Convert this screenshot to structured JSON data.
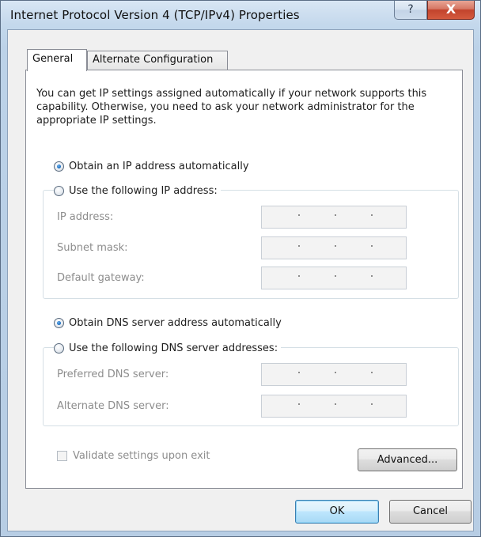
{
  "window": {
    "title": "Internet Protocol Version 4 (TCP/IPv4) Properties",
    "help_glyph": "?",
    "close_glyph": "X"
  },
  "tabs": [
    {
      "label": "General",
      "active": true
    },
    {
      "label": "Alternate Configuration",
      "active": false
    }
  ],
  "general": {
    "description": "You can get IP settings assigned automatically if your network supports this capability. Otherwise, you need to ask your network administrator for the appropriate IP settings.",
    "ip": {
      "auto_label": "Obtain an IP address automatically",
      "manual_label": "Use the following IP address:",
      "selected": "auto",
      "fields": [
        {
          "label": "IP address:",
          "value": ""
        },
        {
          "label": "Subnet mask:",
          "value": ""
        },
        {
          "label": "Default gateway:",
          "value": ""
        }
      ]
    },
    "dns": {
      "auto_label": "Obtain DNS server address automatically",
      "manual_label": "Use the following DNS server addresses:",
      "selected": "auto",
      "fields": [
        {
          "label": "Preferred DNS server:",
          "value": ""
        },
        {
          "label": "Alternate DNS server:",
          "value": ""
        }
      ]
    },
    "validate_label": "Validate settings upon exit",
    "validate_checked": false,
    "advanced_label": "Advanced..."
  },
  "footer": {
    "ok_label": "OK",
    "cancel_label": "Cancel"
  },
  "colors": {
    "accent": "#1d6fc2",
    "disabled_text": "#8d8d8d",
    "close_button": "#c2432c"
  }
}
